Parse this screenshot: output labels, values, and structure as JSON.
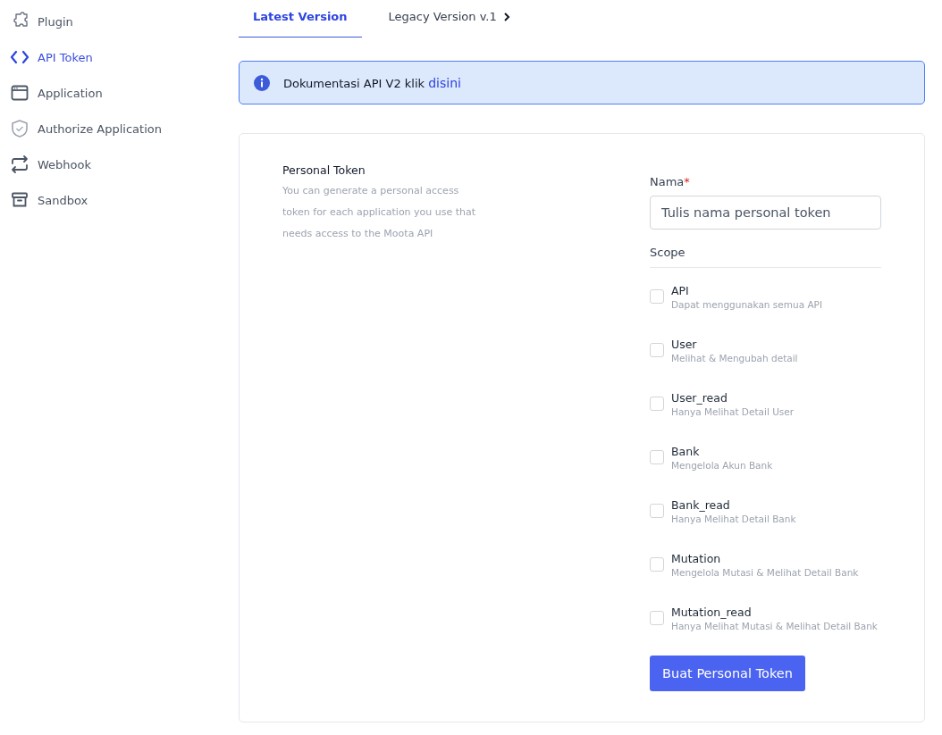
{
  "sidebar": {
    "items": [
      {
        "label": "Plugin",
        "selected": false
      },
      {
        "label": "API Token",
        "selected": true
      },
      {
        "label": "Application",
        "selected": false
      },
      {
        "label": "Authorize Application",
        "selected": false
      },
      {
        "label": "Webhook",
        "selected": false
      },
      {
        "label": "Sandbox",
        "selected": false
      }
    ]
  },
  "tabs": [
    {
      "label": "Latest Version",
      "selected": true
    },
    {
      "label": "Legacy Version v.1",
      "selected": false
    }
  ],
  "alert": {
    "text": "Dokumentasi API V2 klik",
    "link": "disini"
  },
  "form": {
    "title": "Personal Token",
    "description": "You can generate a personal access token for each application you use that needs access to the Moota API",
    "name_label": "Nama",
    "required_mark": "*",
    "name_placeholder": "Tulis nama personal token",
    "scope_label": "Scope",
    "scopes": [
      {
        "name": "API",
        "description": "Dapat menggunakan semua API",
        "checked": false
      },
      {
        "name": "User",
        "description": "Melihat & Mengubah detail",
        "checked": false
      },
      {
        "name": "User_read",
        "description": "Hanya Melihat Detail User",
        "checked": false
      },
      {
        "name": "Bank",
        "description": "Mengelola Akun Bank",
        "checked": false
      },
      {
        "name": "Bank_read",
        "description": "Hanya Melihat Detail Bank",
        "checked": false
      },
      {
        "name": "Mutation",
        "description": "Mengelola Mutasi & Melihat Detail Bank",
        "checked": false
      },
      {
        "name": "Mutation_read",
        "description": "Hanya Melihat Mutasi & Melihat Detail Bank",
        "checked": false
      }
    ],
    "submit": "Buat Personal Token"
  }
}
